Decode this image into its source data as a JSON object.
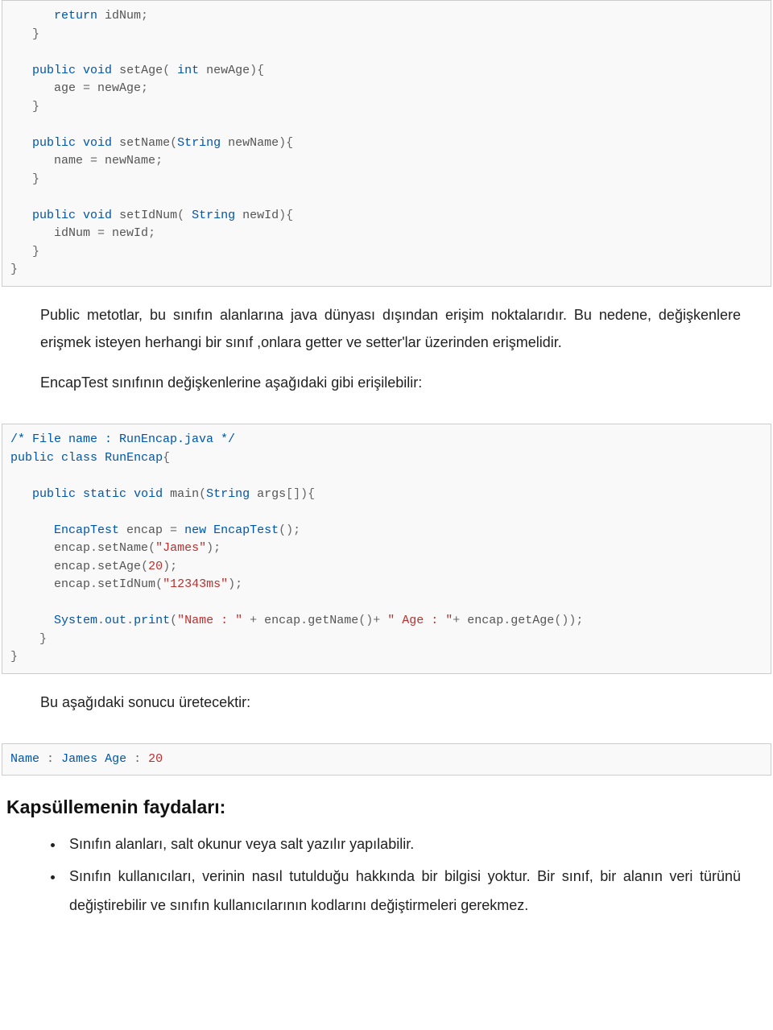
{
  "code1": {
    "l1a": "      ",
    "l1b": "return",
    "l1c": " idNum",
    "l1d": ";",
    "l2": "   }",
    "l3": "",
    "l4a": "   ",
    "l4b": "public",
    "l4c": " ",
    "l4d": "void",
    "l4e": " setAge",
    "l4f": "(",
    "l4g": " ",
    "l4h": "int",
    "l4i": " newAge",
    "l4j": "){",
    "l5a": "      age ",
    "l5b": "=",
    "l5c": " newAge",
    "l5d": ";",
    "l6": "   }",
    "l7": "",
    "l8a": "   ",
    "l8b": "public",
    "l8c": " ",
    "l8d": "void",
    "l8e": " setName",
    "l8f": "(",
    "l8g": "String",
    "l8h": " newName",
    "l8i": "){",
    "l9a": "      name ",
    "l9b": "=",
    "l9c": " newName",
    "l9d": ";",
    "l10": "   }",
    "l11": "",
    "l12a": "   ",
    "l12b": "public",
    "l12c": " ",
    "l12d": "void",
    "l12e": " setIdNum",
    "l12f": "(",
    "l12g": " ",
    "l12h": "String",
    "l12i": " newId",
    "l12j": "){",
    "l13a": "      idNum ",
    "l13b": "=",
    "l13c": " newId",
    "l13d": ";",
    "l14": "   }",
    "l15": "}"
  },
  "para1": "Public metotlar, bu sınıfın alanlarına java dünyası dışından erişim noktalarıdır. Bu nedene, değişkenlere erişmek isteyen herhangi bir sınıf ,onlara getter ve setter'lar üzerinden erişmelidir.",
  "para2": "EncapTest sınıfının değişkenlerine aşağıdaki gibi erişilebilir:",
  "code2": {
    "l1a": "/* File name : RunEncap.java */",
    "l2a": "public",
    "l2b": " ",
    "l2c": "class",
    "l2d": " ",
    "l2e": "RunEncap",
    "l2f": "{",
    "l3": "",
    "l4a": "   ",
    "l4b": "public",
    "l4c": " ",
    "l4d": "static",
    "l4e": " ",
    "l4f": "void",
    "l4g": " main",
    "l4h": "(",
    "l4i": "String",
    "l4j": " args",
    "l4k": "[]){",
    "l5": "",
    "l6a": "      ",
    "l6b": "EncapTest",
    "l6c": " encap ",
    "l6d": "=",
    "l6e": " ",
    "l6f": "new",
    "l6g": " ",
    "l6h": "EncapTest",
    "l6i": "();",
    "l7a": "      encap",
    "l7b": ".",
    "l7c": "setName",
    "l7d": "(",
    "l7e": "\"James\"",
    "l7f": ");",
    "l8a": "      encap",
    "l8b": ".",
    "l8c": "setAge",
    "l8d": "(",
    "l8e": "20",
    "l8f": ");",
    "l9a": "      encap",
    "l9b": ".",
    "l9c": "setIdNum",
    "l9d": "(",
    "l9e": "\"12343ms\"",
    "l9f": ");",
    "l10": "",
    "l11a": "      ",
    "l11b": "System",
    "l11c": ".",
    "l11d": "out",
    "l11e": ".",
    "l11f": "print",
    "l11g": "(",
    "l11h": "\"Name : \"",
    "l11i": " ",
    "l11j": "+",
    "l11k": " encap",
    "l11l": ".",
    "l11m": "getName",
    "l11n": "()+",
    "l11o": " ",
    "l11p": "\" Age : \"",
    "l11q": "+",
    "l11r": " encap",
    "l11s": ".",
    "l11t": "getAge",
    "l11u": "());",
    "l12": "    }",
    "l13": "}"
  },
  "para3": "Bu aşağıdaki sonucu üretecektir:",
  "code3": {
    "l1a": "Name",
    "l1b": " ",
    "l1c": ":",
    "l1d": " ",
    "l1e": "James",
    "l1f": " ",
    "l1g": "Age",
    "l1h": " ",
    "l1i": ":",
    "l1j": " ",
    "l1k": "20"
  },
  "heading": "Kapsüllemenin faydaları:",
  "benefits": {
    "item1": "Sınıfın alanları, salt okunur veya salt yazılır yapılabilir.",
    "item2": "Sınıfın kullanıcıları, verinin nasıl tutulduğu hakkında bir bilgisi yoktur. Bir sınıf, bir alanın veri türünü değiştirebilir ve sınıfın kullanıcılarının kodlarını değiştirmeleri gerekmez."
  }
}
